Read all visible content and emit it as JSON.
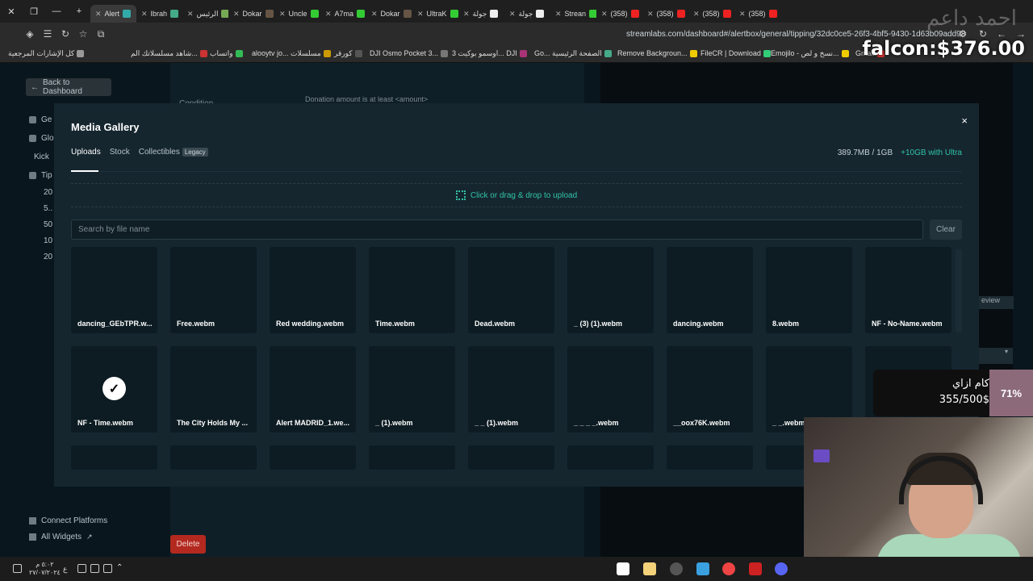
{
  "browser": {
    "tabs": [
      {
        "label": "Alert",
        "active": true,
        "color": "#3aa"
      },
      {
        "label": "Ibrah",
        "color": "#4a8"
      },
      {
        "label": "الرئيس",
        "color": "#7a5"
      },
      {
        "label": "Dokar",
        "color": "#654"
      },
      {
        "label": "Uncle",
        "color": "#3c3"
      },
      {
        "label": "A7ma",
        "color": "#3c3"
      },
      {
        "label": "Dokar",
        "color": "#654"
      },
      {
        "label": "UltraK",
        "color": "#3c3"
      },
      {
        "label": "جولة",
        "color": "#eee"
      },
      {
        "label": "جولة",
        "color": "#eee"
      },
      {
        "label": "Strean",
        "color": "#3c3"
      },
      {
        "label": "(358)",
        "color": "#e22"
      },
      {
        "label": "(358)",
        "color": "#e22"
      },
      {
        "label": "(358)",
        "color": "#e22"
      },
      {
        "label": "(358)",
        "color": "#e22"
      }
    ],
    "url": "streamlabs.com/dashboard#/alertbox/general/tipping/32dc0ce5-26f3-4bf5-9430-1d63b09add98",
    "bookmarks": [
      {
        "label": "كل الإشارات المرجعية",
        "color": "#999"
      },
      {
        "label": "شاهد مسلسلاتك الم...",
        "color": "#c33"
      },
      {
        "label": "واتساب",
        "color": "#3b5"
      },
      {
        "label": "alooytv jo... مسلسلات",
        "color": "#c90"
      },
      {
        "label": "كورقر",
        "color": "#555"
      },
      {
        "label": "DJI Osmo Pocket 3...",
        "color": "#777"
      },
      {
        "label": "اوسمو بوكيت 3... DJI",
        "color": "#a37"
      },
      {
        "label": "Go... الصفحة الرئيسية",
        "color": "#4a8"
      },
      {
        "label": "Remove Backgroun...",
        "color": "#ec0"
      },
      {
        "label": "FileCR | Download",
        "color": "#3c7"
      },
      {
        "label": "Emojilo - نسخ و لص...",
        "color": "#ec0"
      },
      {
        "label": "Gmail",
        "color": "#d33"
      }
    ]
  },
  "overlays": {
    "money": "falcon:$376.00",
    "goal_title": "كام ازاي",
    "goal_value": "355/500$",
    "goal_percent": "71%",
    "goal_fill": 0.71
  },
  "page": {
    "back_label": "Back to Dashboard",
    "sidebar": [
      {
        "label": "Ge"
      },
      {
        "label": "Glo"
      },
      {
        "label": "Kick"
      },
      {
        "label": "Tip"
      },
      {
        "label": "20"
      },
      {
        "label": "5.."
      },
      {
        "label": "50"
      },
      {
        "label": "10"
      },
      {
        "label": "20"
      }
    ],
    "sidebar_bottom": [
      {
        "label": "Connect Platforms"
      },
      {
        "label": "All Widgets"
      }
    ],
    "condition_label": "Condition",
    "condition_value": "Donation amount is at least <amount>",
    "preview_label": "eview",
    "delete_label": "Delete"
  },
  "modal": {
    "title": "Media Gallery",
    "close": "×",
    "tabs": [
      {
        "label": "Uploads",
        "active": true
      },
      {
        "label": "Stock"
      },
      {
        "label": "Collectibles",
        "badge": "Legacy"
      }
    ],
    "storage_used": "389.7MB / 1GB",
    "storage_upgrade": "+10GB with Ultra",
    "upload_prompt": "Click or drag & drop to upload",
    "search_placeholder": "Search by file name",
    "clear_label": "Clear",
    "files": [
      [
        "dancing_GEbTPR.w...",
        "Free.webm",
        "Red wedding.webm",
        "Time.webm",
        "Dead.webm",
        "_ (3) (1).webm",
        "dancing.webm",
        "8.webm",
        "NF - No-Name.webm"
      ],
      [
        "NF - Time.webm",
        "The City Holds My ...",
        "Alert MADRID_1.we...",
        "_ (1).webm",
        "_ _ (1).webm",
        "_ _ _ _.webm",
        "__oox76K.webm",
        "_ _.webm",
        ""
      ],
      [
        "",
        "",
        "",
        "",
        "",
        "",
        "",
        "",
        ""
      ]
    ],
    "selected_file": "NF - Time.webm"
  },
  "taskbar": {
    "time": "٥:٠٢ م",
    "date": "٢٧/٠٧/٢٠٢٤",
    "lang": "ع"
  }
}
